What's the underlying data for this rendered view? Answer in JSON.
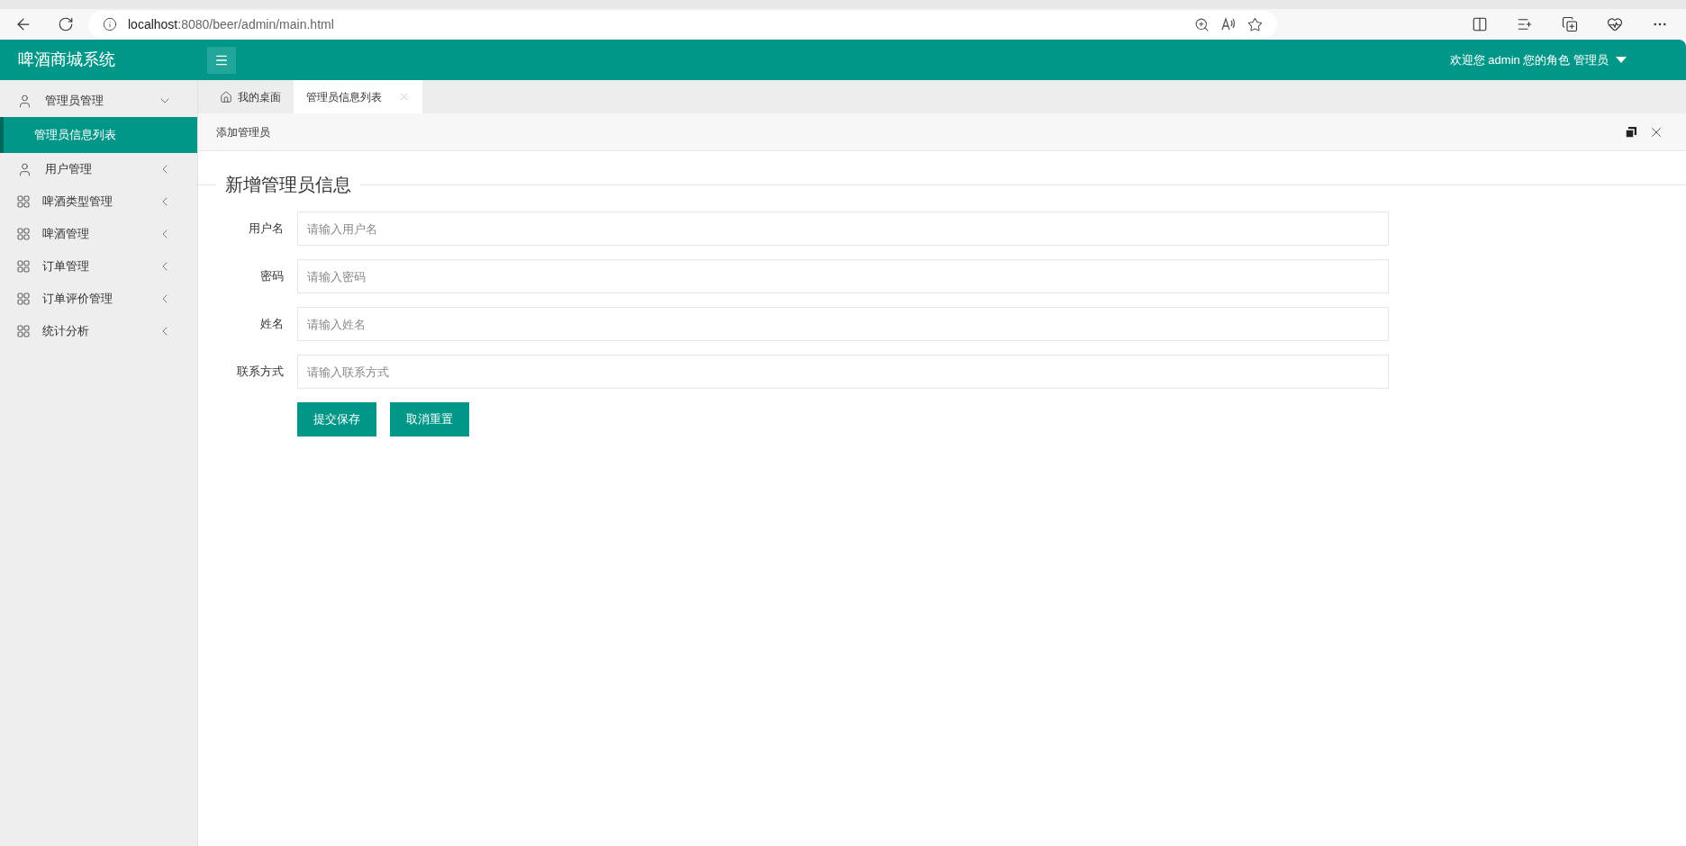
{
  "browser": {
    "url_host": "localhost",
    "url_path": ":8080/beer/admin/main.html"
  },
  "header": {
    "title": "啤酒商城系统",
    "user_info": "欢迎您 admin 您的角色 管理员"
  },
  "sidebar": {
    "items": [
      {
        "label": "管理员管理",
        "kind": "user",
        "expanded": true,
        "children": [
          {
            "label": "管理员信息列表",
            "selected": true
          }
        ]
      },
      {
        "label": "用户管理",
        "kind": "user",
        "expanded": false
      },
      {
        "label": "啤酒类型管理",
        "kind": "grid",
        "expanded": false
      },
      {
        "label": "啤酒管理",
        "kind": "grid",
        "expanded": false
      },
      {
        "label": "订单管理",
        "kind": "grid",
        "expanded": false
      },
      {
        "label": "订单评价管理",
        "kind": "grid",
        "expanded": false
      },
      {
        "label": "统计分析",
        "kind": "grid",
        "expanded": false
      }
    ]
  },
  "tabs": [
    {
      "label": "我的桌面",
      "kind": "home",
      "selected": false
    },
    {
      "label": "管理员信息列表",
      "kind": "closable",
      "selected": true
    }
  ],
  "panel": {
    "title": "添加管理员",
    "legend": "新增管理员信息",
    "fields": [
      {
        "label": "用户名",
        "placeholder": "请输入用户名"
      },
      {
        "label": "密码",
        "placeholder": "请输入密码"
      },
      {
        "label": "姓名",
        "placeholder": "请输入姓名"
      },
      {
        "label": "联系方式",
        "placeholder": "请输入联系方式"
      }
    ],
    "buttons": [
      "提交保存",
      "取消重置"
    ]
  }
}
